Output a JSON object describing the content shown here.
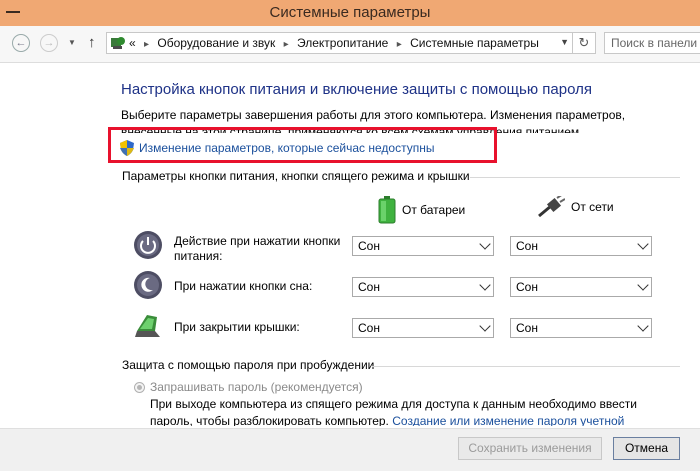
{
  "window": {
    "title": "Системные параметры"
  },
  "navbar": {
    "breadcrumbs": [
      "Оборудование и звук",
      "Электропитание",
      "Системные параметры"
    ],
    "overflow_marker": "«",
    "search_placeholder": "Поиск в панели уп"
  },
  "page": {
    "heading": "Настройка кнопок питания и включение защиты с помощью пароля",
    "description": "Выберите параметры завершения работы для этого компьютера. Изменения параметров, внесенные на этой странице, применяются ко всем схемам управления питанием.",
    "change_link": "Изменение параметров, которые сейчас недоступны",
    "power_section_title": "Параметры кнопки питания, кнопки спящего режима и крышки",
    "columns": {
      "battery": "От батареи",
      "ac": "От сети"
    },
    "rows": [
      {
        "label": "Действие при нажатии кнопки питания:",
        "battery": "Сон",
        "ac": "Сон"
      },
      {
        "label": "При нажатии кнопки сна:",
        "battery": "Сон",
        "ac": "Сон"
      },
      {
        "label": "При закрытии крышки:",
        "battery": "Сон",
        "ac": "Сон"
      }
    ],
    "password_section_title": "Защита с помощью пароля при пробуждении",
    "password_option": "Запрашивать пароль (рекомендуется)",
    "password_option_desc": "При выходе компьютера из спящего режима для доступа к данным необходимо ввести пароль, чтобы разблокировать компьютер.",
    "password_option_link": "Создание или изменение пароля учетной записи"
  },
  "footer": {
    "save": "Сохранить изменения",
    "cancel": "Отмена"
  },
  "colors": {
    "titlebar": "#f0a873",
    "link": "#1a4f9c",
    "heading": "#1e3287",
    "highlight": "#e8112d"
  }
}
